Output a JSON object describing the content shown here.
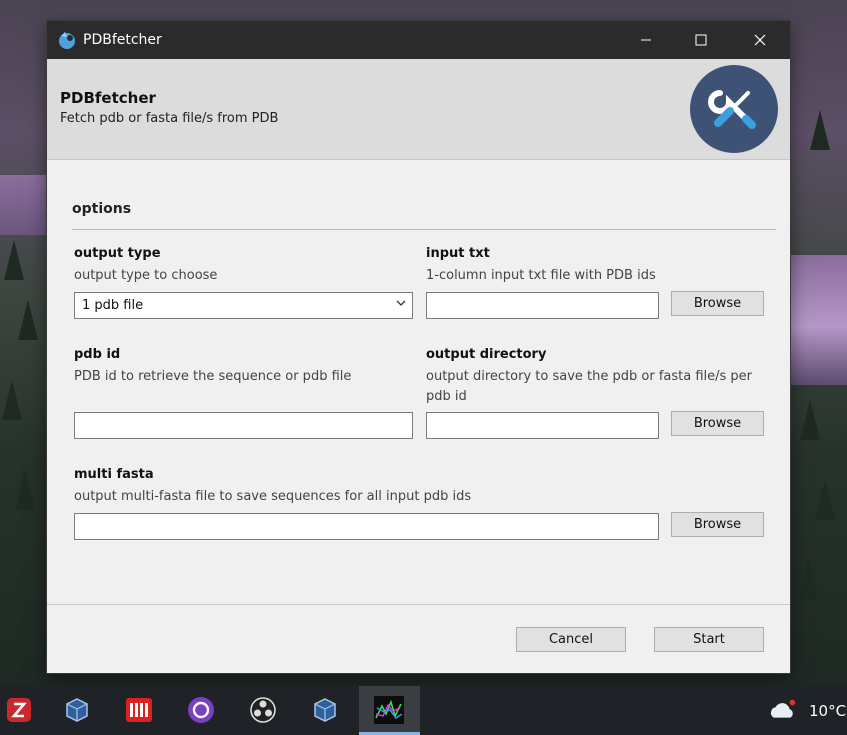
{
  "window": {
    "title": "PDBfetcher",
    "controls": {
      "minimize": "—",
      "maximize": "☐",
      "close": "✕"
    }
  },
  "header": {
    "title": "PDBfetcher",
    "subtitle": "Fetch pdb or fasta file/s from PDB",
    "icon": "tools-icon"
  },
  "options": {
    "section_title": "options",
    "output_type": {
      "label": "output type",
      "description": "output type to choose",
      "selected": "1 pdb file"
    },
    "input_txt": {
      "label": "input txt",
      "description": "1-column input txt file with PDB ids",
      "value": "",
      "browse_label": "Browse"
    },
    "pdb_id": {
      "label": "pdb id",
      "description": "PDB id to retrieve the sequence or pdb file",
      "value": ""
    },
    "output_directory": {
      "label": "output directory",
      "description": "output directory to save the pdb or fasta file/s per pdb id",
      "value": "",
      "browse_label": "Browse"
    },
    "multi_fasta": {
      "label": "multi fasta",
      "description": "output multi-fasta file to save sequences for all input pdb ids",
      "value": "",
      "browse_label": "Browse"
    }
  },
  "footer": {
    "cancel_label": "Cancel",
    "start_label": "Start"
  },
  "taskbar": {
    "apps": [
      "zotero-icon",
      "virtualbox-icon",
      "imagej-icon",
      "github-desktop-icon",
      "obs-icon",
      "virtualbox-icon",
      "chart-app-icon"
    ],
    "temperature": "10°C",
    "weather_icon": "cloud-icon"
  },
  "colors": {
    "titlebar": "#2b2b2b",
    "header_bg": "#dcdcdc",
    "header_icon_bg": "#3e5275",
    "window_bg": "#f0f0f0",
    "taskbar": "#1f2226"
  }
}
